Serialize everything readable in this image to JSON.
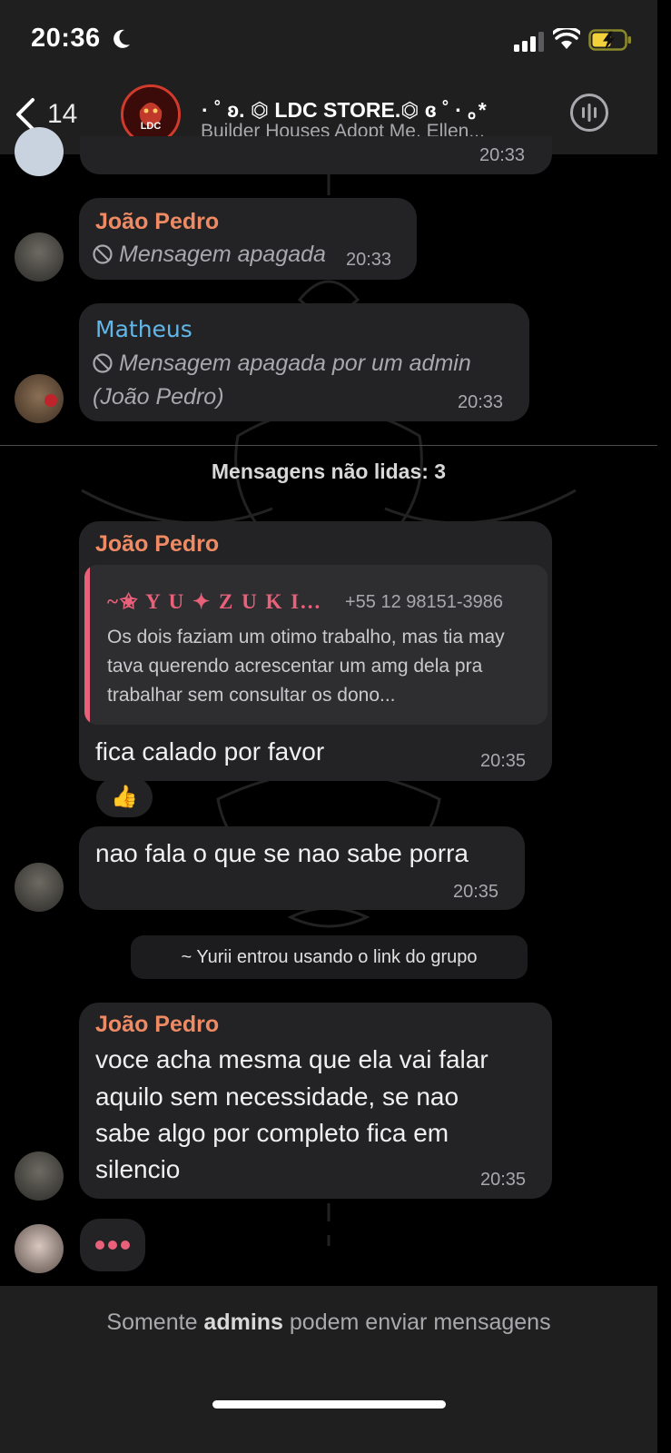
{
  "status_bar": {
    "time": "20:36"
  },
  "header": {
    "back_count": "14",
    "avatar_text": "LDC",
    "title": "· ˚ ʚ. ⏣ LDC STORE.⏣ ɞ ˚ · ｡*",
    "subtitle": "Builder Houses Adopt Me, Ellen..."
  },
  "messages": [
    {
      "time": "20:33"
    },
    {
      "sender": "João Pedro",
      "text": "Mensagem apagada",
      "time": "20:33"
    },
    {
      "sender": "Matheus",
      "text_line1": "Mensagem apagada por um admin",
      "text_line2": "(João Pedro)",
      "time": "20:33"
    },
    {
      "sender": "João Pedro",
      "quote_name": "~✬ Y U ✦ Z U K I...",
      "quote_phone": "+55 12 98151-3986",
      "quote_text": "Os dois faziam um otimo trabalho, mas tia may tava querendo acrescentar um amg dela pra trabalhar sem consultar os dono...",
      "text": "fica calado por favor",
      "time": "20:35",
      "reaction": "👍"
    },
    {
      "text": "nao fala o que se nao sabe porra",
      "time": "20:35"
    },
    {
      "sender": "João Pedro",
      "lines": [
        "voce acha mesma que ela vai falar",
        "aquilo sem necessidade, se nao",
        "sabe algo por completo fica em",
        "silencio"
      ],
      "time": "20:35"
    }
  ],
  "unread_label": "Mensagens não lidas: 3",
  "system_message": "~ Yurii entrou usando o link do grupo",
  "footer": {
    "prefix": "Somente ",
    "bold": "admins",
    "suffix": " podem enviar mensagens"
  },
  "colors": {
    "accent_orange": "#ee8a64",
    "accent_blue": "#62b7e9",
    "quote_pink": "#e8607a"
  }
}
